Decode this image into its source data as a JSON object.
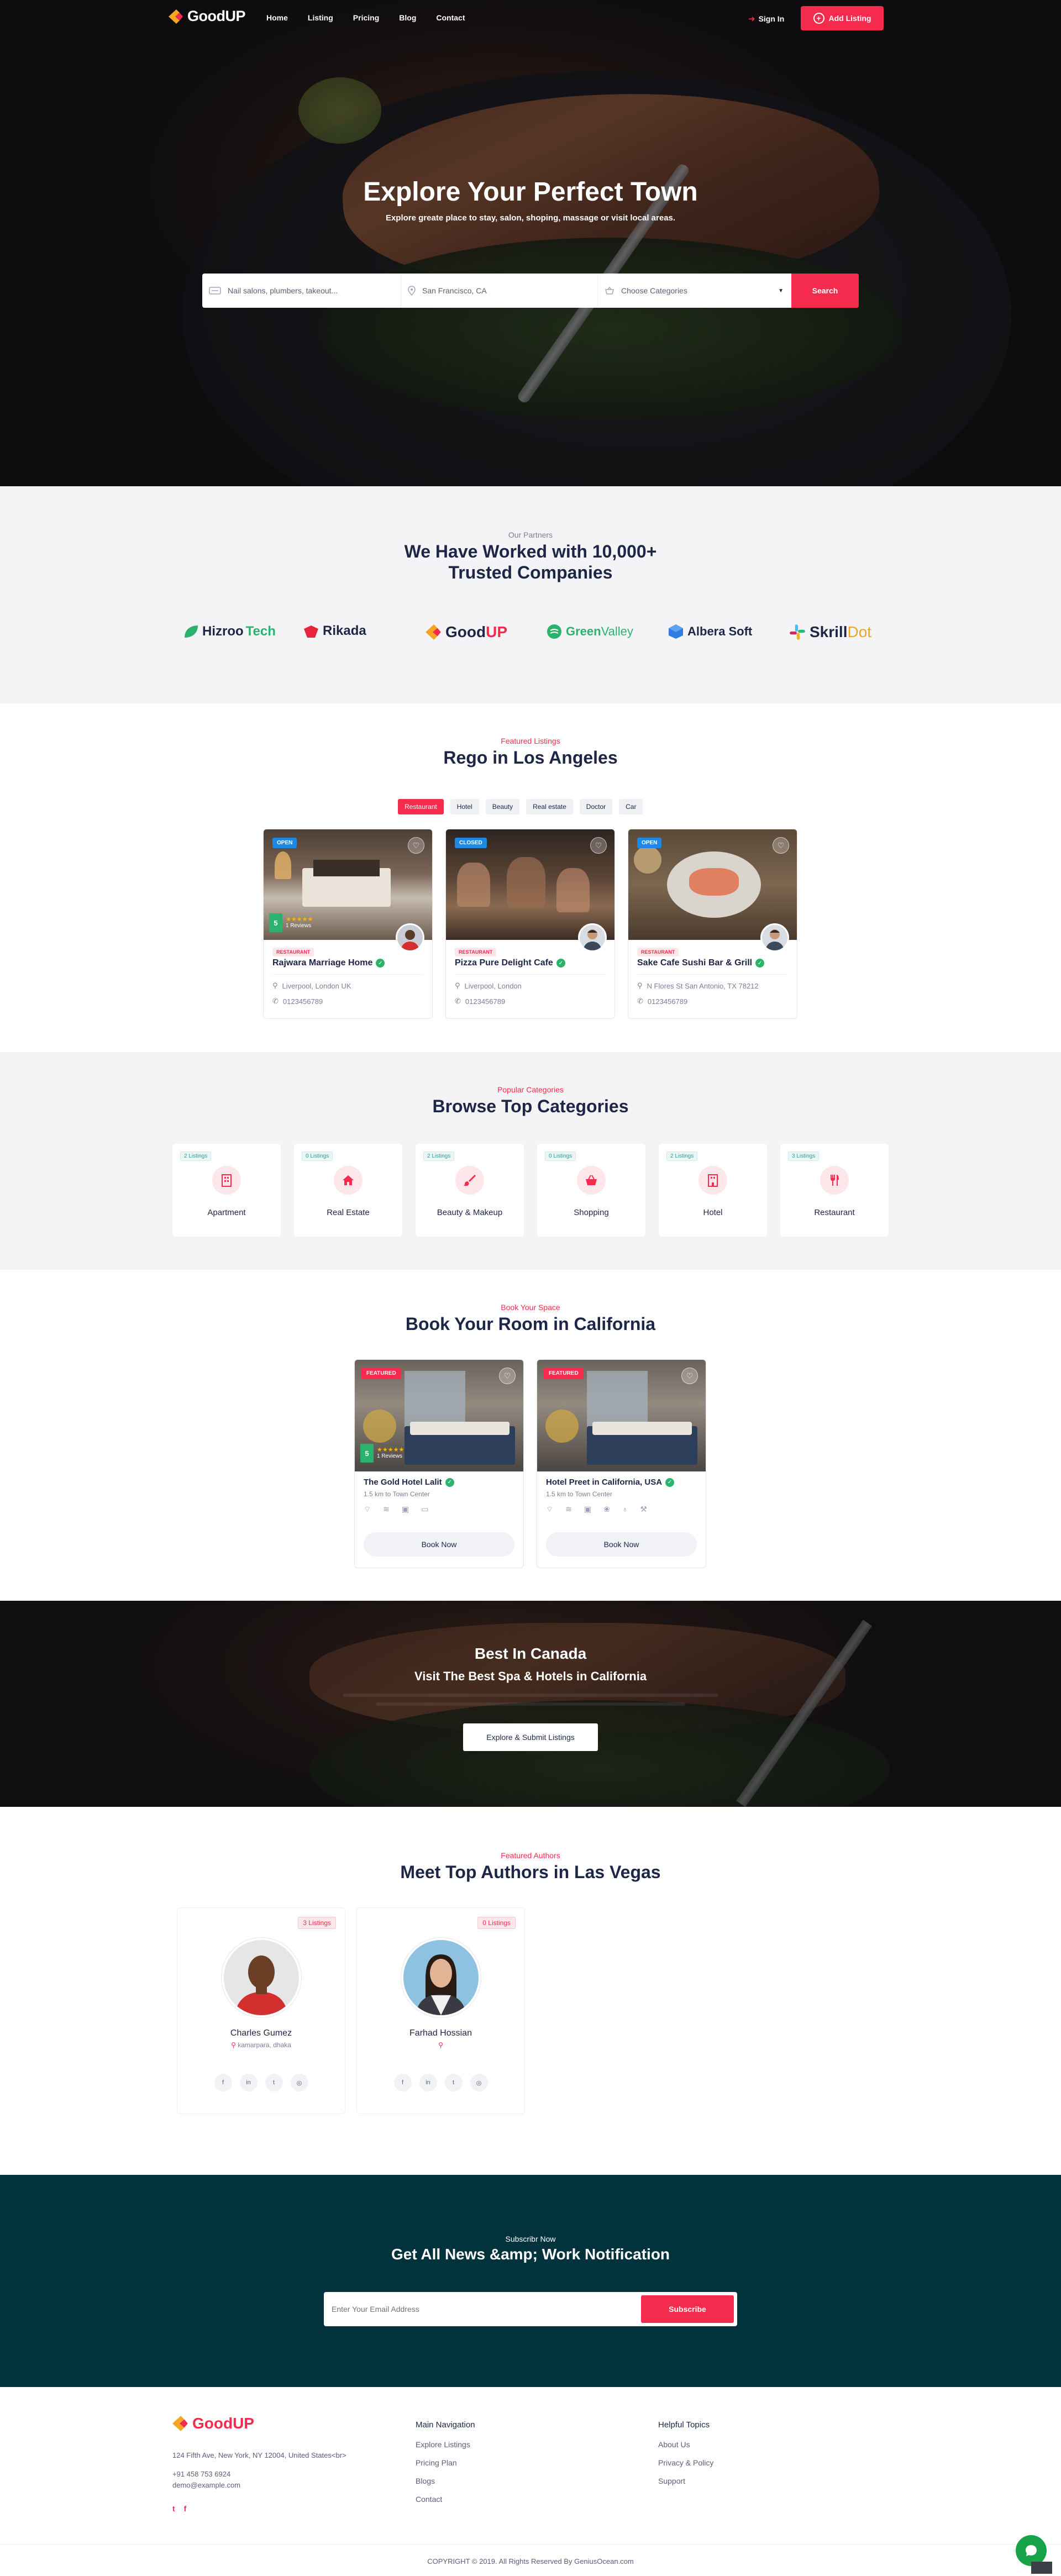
{
  "header": {
    "brand": "GoodUP",
    "nav": [
      "Home",
      "Listing",
      "Pricing",
      "Blog",
      "Contact"
    ],
    "signin": "Sign In",
    "add_listing": "Add Listing"
  },
  "hero": {
    "title": "Explore Your Perfect Town",
    "subtitle": "Explore greate place to stay, salon, shoping, massage or visit local areas.",
    "search": {
      "keyword_placeholder": "Nail salons, plumbers, takeout...",
      "location_value": "San Francisco, CA",
      "category_value": "Choose Categories",
      "button": "Search"
    }
  },
  "partners": {
    "eyebrow": "Our Partners",
    "title_line1": "We Have Worked with 10,000+",
    "title_line2": "Trusted Companies",
    "logos": [
      {
        "name": "Hizroo",
        "suffix": "Tech",
        "icon": "leaf-icon",
        "color": "#2ab36c"
      },
      {
        "name": "Rikada",
        "suffix": "",
        "icon": "bird-icon",
        "color": "#e8243c"
      },
      {
        "name": "Good",
        "suffix": "UP",
        "icon": "arrow-icon",
        "color": "#f5a623"
      },
      {
        "name": "Green",
        "suffix": "Valley",
        "icon": "circle-icon",
        "color": "#2ab36c"
      },
      {
        "name": "Albera",
        "suffix": "Soft",
        "icon": "cube-icon",
        "color": "#2f7de1"
      },
      {
        "name": "Skrill",
        "suffix": "Dot",
        "icon": "slack-icon",
        "color": "#e8a623"
      }
    ]
  },
  "featured": {
    "eyebrow": "Featured Listings",
    "title": "Rego in Los Angeles",
    "filters": [
      "Restaurant",
      "Hotel",
      "Beauty",
      "Real estate",
      "Doctor",
      "Car"
    ],
    "active_filter": "Restaurant",
    "listings": [
      {
        "status": "OPEN",
        "category": "RESTAURANT",
        "name": "Rajwara Marriage Home",
        "location": "Liverpool, London UK",
        "phone": "0123456789",
        "rating": "5",
        "reviews": "1 Reviews",
        "status_color": "#1e88e5"
      },
      {
        "status": "CLOSED",
        "category": "RESTAURANT",
        "name": "Pizza Pure Delight Cafe",
        "location": "Liverpool, London",
        "phone": "0123456789",
        "status_color": "#1e88e5"
      },
      {
        "status": "OPEN",
        "category": "RESTAURANT",
        "name": "Sake Cafe Sushi Bar & Grill",
        "location": "N Flores St San Antonio, TX 78212",
        "phone": "0123456789",
        "status_color": "#1e88e5"
      }
    ]
  },
  "categories": {
    "eyebrow": "Popular Categories",
    "title": "Browse Top Categories",
    "items": [
      {
        "count": "2 Listings",
        "name": "Apartment",
        "icon": "building-icon"
      },
      {
        "count": "0 Listings",
        "name": "Real Estate",
        "icon": "home-icon"
      },
      {
        "count": "2 Listings",
        "name": "Beauty & Makeup",
        "icon": "brush-icon"
      },
      {
        "count": "0 Listings",
        "name": "Shopping",
        "icon": "basket-icon"
      },
      {
        "count": "2 Listings",
        "name": "Hotel",
        "icon": "hotel-icon"
      },
      {
        "count": "3 Listings",
        "name": "Restaurant",
        "icon": "utensils-icon"
      }
    ]
  },
  "rooms": {
    "eyebrow": "Book Your Space",
    "title": "Book Your Room in California",
    "items": [
      {
        "badge": "FEATURED",
        "name": "The Gold Hotel Lalit",
        "distance": "1.5 km to Town Center",
        "rating": "5",
        "reviews": "1 Reviews",
        "button": "Book Now"
      },
      {
        "badge": "FEATURED",
        "name": "Hotel Preet in California, USA",
        "distance": "1.5 km to Town Center",
        "button": "Book Now"
      }
    ]
  },
  "cta": {
    "title": "Best In Canada",
    "subtitle": "Visit The Best Spa & Hotels in California",
    "button": "Explore & Submit Listings"
  },
  "authors": {
    "eyebrow": "Featured Authors",
    "title": "Meet Top Authors in Las Vegas",
    "items": [
      {
        "listings": "3 Listings",
        "name": "Charles Gumez",
        "location": "kamarpara, dhaka"
      },
      {
        "listings": "0 Listings",
        "name": "Farhad Hossian",
        "location": ""
      }
    ]
  },
  "newsletter": {
    "eyebrow": "Subscribr Now",
    "title": "Get All News &amp; Work Notification",
    "placeholder": "Enter Your Email Address",
    "button": "Subscribe"
  },
  "footer": {
    "brand": "GoodUP",
    "address": "124 Fifth Ave, New York, NY 12004, United States<br>",
    "phone": "+91 458 753 6924",
    "email": "demo@example.com",
    "main_nav_title": "Main Navigation",
    "main_nav": [
      "Explore Listings",
      "Pricing Plan",
      "Blogs",
      "Contact"
    ],
    "helpful_title": "Helpful Topics",
    "helpful": [
      "About Us",
      "Privacy & Policy",
      "Support"
    ],
    "copyright": "COPYRIGHT © 2019. All Rights Reserved By GeniusOcean.com"
  }
}
